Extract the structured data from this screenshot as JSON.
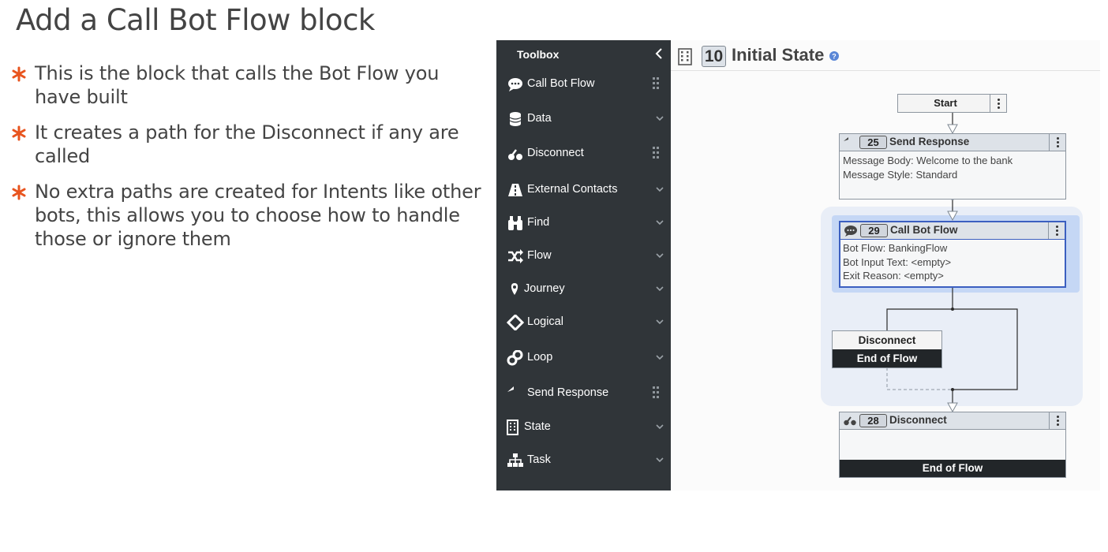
{
  "slide": {
    "title": "Add a Call Bot Flow block",
    "bullets": [
      "This is the block that calls the Bot Flow you have built",
      "It creates a path for the Disconnect if any are called",
      "No extra paths are created for Intents like other bots, this allows you to choose how to handle those or ignore them"
    ],
    "accent_color": "#e8541e"
  },
  "toolbox": {
    "title": "Toolbox",
    "items": [
      {
        "label": "Call Bot Flow",
        "icon": "chat-bubble-icon",
        "control": "drag-grip"
      },
      {
        "label": "Data",
        "icon": "database-icon",
        "control": "chevron"
      },
      {
        "label": "Disconnect",
        "icon": "disconnect-icon",
        "control": "drag-grip"
      },
      {
        "label": "External Contacts",
        "icon": "road-icon",
        "control": "chevron"
      },
      {
        "label": "Find",
        "icon": "binoculars-icon",
        "control": "chevron"
      },
      {
        "label": "Flow",
        "icon": "shuffle-icon",
        "control": "chevron"
      },
      {
        "label": "Journey",
        "icon": "map-pin-icon",
        "control": "chevron"
      },
      {
        "label": "Logical",
        "icon": "diamond-icon",
        "control": "chevron"
      },
      {
        "label": "Loop",
        "icon": "link-icon",
        "control": "chevron"
      },
      {
        "label": "Send Response",
        "icon": "reply-icon",
        "control": "drag-grip"
      },
      {
        "label": "State",
        "icon": "building-icon",
        "control": "chevron"
      },
      {
        "label": "Task",
        "icon": "sitemap-icon",
        "control": "chevron"
      }
    ],
    "background": "#303539"
  },
  "state": {
    "number": "10",
    "title": "Initial State"
  },
  "flow": {
    "start_label": "Start",
    "send_response": {
      "number": "25",
      "title": "Send Response",
      "lines": [
        "Message Body: Welcome to the bank",
        "Message Style: Standard"
      ]
    },
    "call_bot_flow": {
      "number": "29",
      "title": "Call Bot Flow",
      "lines": [
        "Bot Flow: BankingFlow",
        "Bot Input Text: <empty>",
        "Exit Reason: <empty>"
      ]
    },
    "disconnect_path": {
      "label": "Disconnect",
      "end_label": "End of Flow"
    },
    "disconnect_block": {
      "number": "28",
      "title": "Disconnect",
      "end_label": "End of Flow"
    },
    "selected_color": "#3b5fc0"
  }
}
